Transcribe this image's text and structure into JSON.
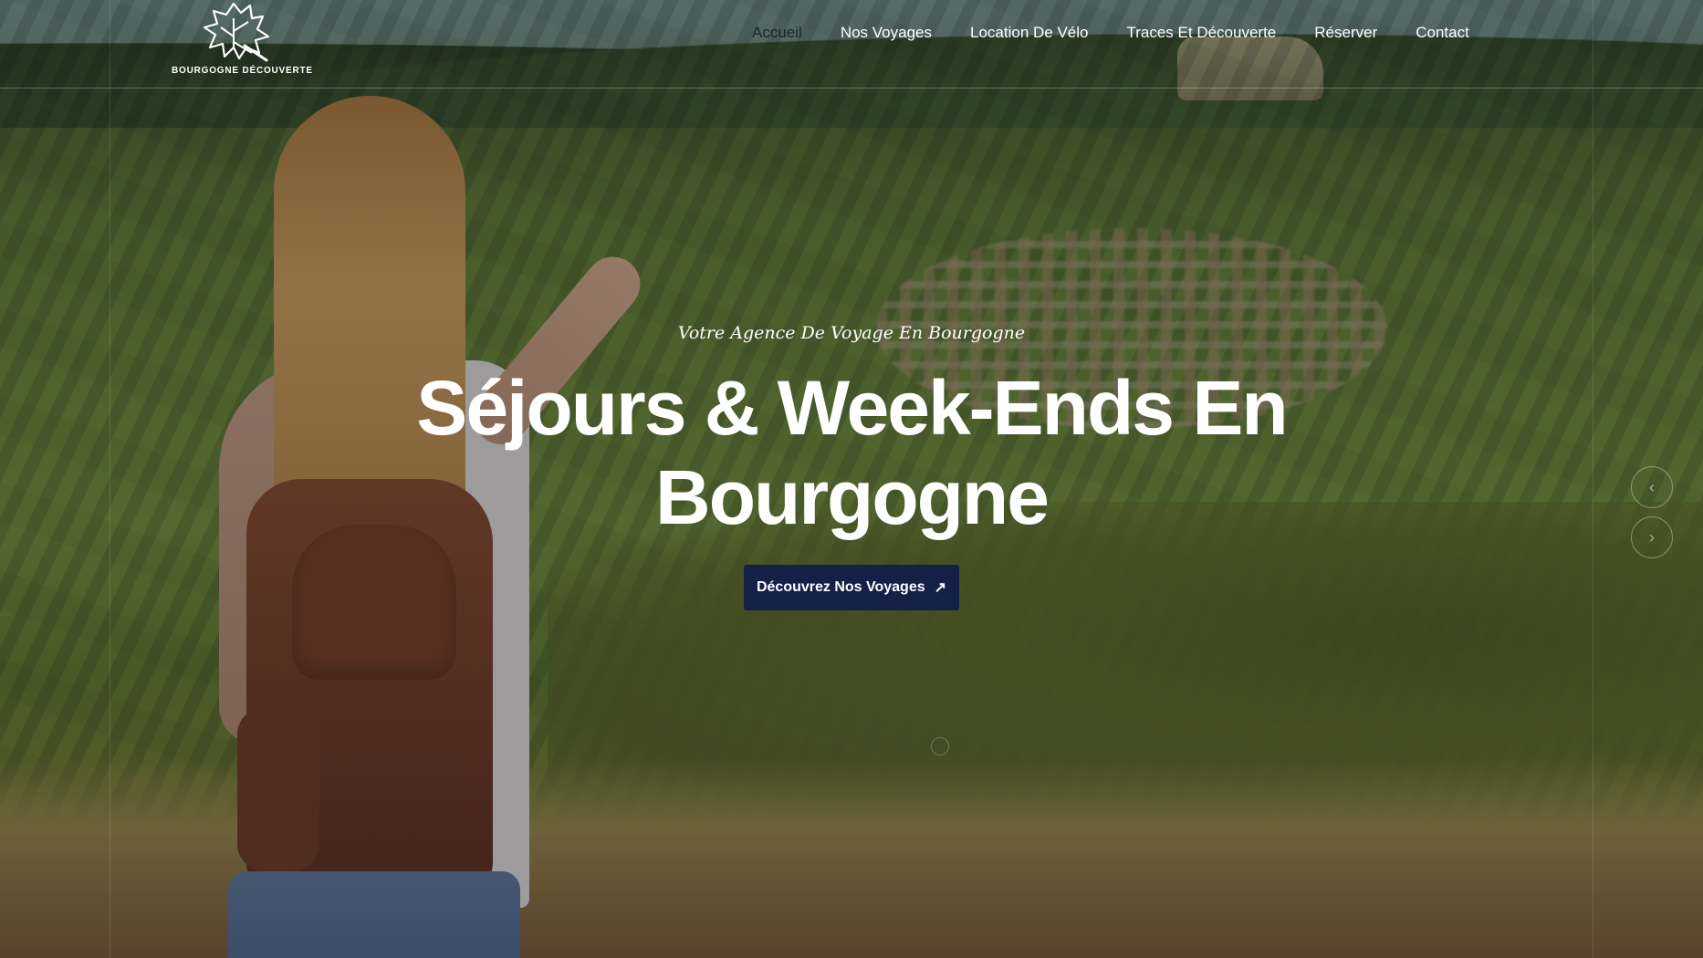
{
  "logo": {
    "text": "BOURGOGNE DÉCOUVERTE",
    "icon": "vine-leaf-logo-icon"
  },
  "nav": {
    "items": [
      {
        "label": "Accueil",
        "active": true
      },
      {
        "label": "Nos Voyages"
      },
      {
        "label": "Location De Vélo"
      },
      {
        "label": "Traces Et Découverte"
      },
      {
        "label": "Réserver"
      },
      {
        "label": "Contact"
      }
    ]
  },
  "hero": {
    "subtitle": "Votre Agence De Voyage En Bourgogne",
    "title_line1": "Séjours & Week-Ends En",
    "title_line2": "Bourgogne",
    "cta_label": "Découvrez Nos Voyages",
    "cta_icon": "arrow-up-right-icon"
  },
  "slider": {
    "prev_icon": "chevron-left-icon",
    "next_icon": "chevron-right-icon"
  },
  "colors": {
    "cta_bg": "#142046",
    "nav_active": "#1b2433",
    "text": "#ffffff"
  }
}
